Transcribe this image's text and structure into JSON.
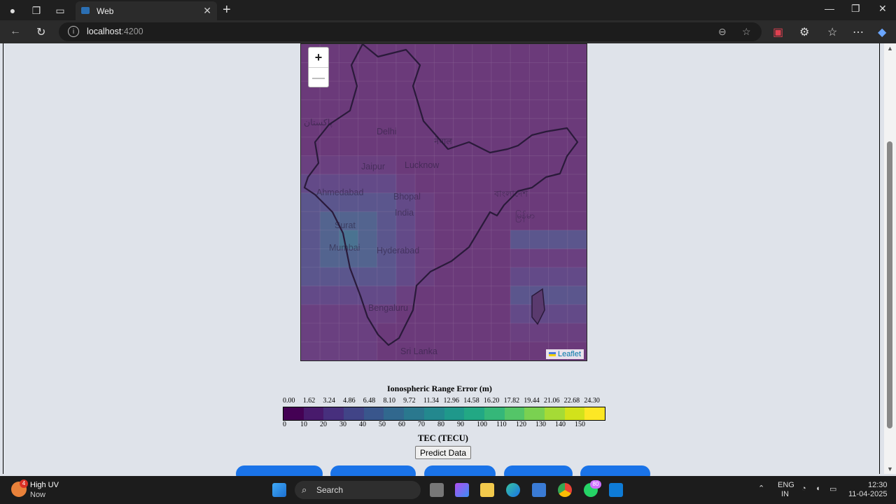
{
  "browser": {
    "tab_title": "Web",
    "url_host": "localhost",
    "url_port": ":4200"
  },
  "map": {
    "zoom_in": "+",
    "zoom_out": "—",
    "attribution": "Leaflet",
    "cities": [
      "Delhi",
      "Jaipur",
      "Lucknow",
      "Ahmedabad",
      "Bhopal",
      "India",
      "Surat",
      "Mumbai",
      "Hyderabad",
      "Bengaluru",
      "Sri Lanka"
    ],
    "script_labels": [
      "پاکستان",
      "नेपाल",
      "বাংলাদেশ",
      "မြန်မာ"
    ]
  },
  "legend": {
    "title": "Ionospheric Range Error (m)",
    "range_labels": [
      "0.00",
      "1.62",
      "3.24",
      "4.86",
      "6.48",
      "8.10",
      "9.72",
      "11.34",
      "12.96",
      "14.58",
      "16.20",
      "17.82",
      "19.44",
      "21.06",
      "22.68",
      "24.30"
    ],
    "tec_labels": [
      "0",
      "10",
      "20",
      "30",
      "40",
      "50",
      "60",
      "70",
      "80",
      "90",
      "100",
      "110",
      "120",
      "130",
      "140",
      "150"
    ],
    "colors": [
      "#440154",
      "#481a6c",
      "#472f7d",
      "#414487",
      "#39568c",
      "#31688e",
      "#2a788e",
      "#23888e",
      "#1f988b",
      "#22a884",
      "#35b779",
      "#54c568",
      "#7ad151",
      "#a5db36",
      "#d2e21b",
      "#fde725"
    ],
    "unit_label": "TEC (TECU)"
  },
  "actions": {
    "predict": "Predict Data"
  },
  "taskbar": {
    "weather_title": "High UV",
    "weather_sub": "Now",
    "weather_badge": "4",
    "search": "Search",
    "whatsapp_badge": "80",
    "lang1": "ENG",
    "lang2": "IN",
    "time": "12:30",
    "date": "11-04-2025"
  }
}
